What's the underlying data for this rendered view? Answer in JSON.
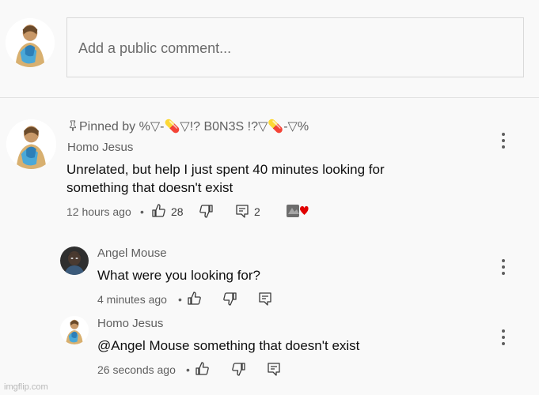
{
  "new_comment": {
    "placeholder": "Add a public comment..."
  },
  "pinned_comment": {
    "pinned_label": "Pinned by %▽-💊▽!? B0N3S !?▽💊-▽%",
    "author": "Homo Jesus",
    "text_line1": "Unrelated, but help I just spent 40 minutes looking for",
    "text_line2": "something that doesn't exist",
    "time": "12 hours ago",
    "likes": "28",
    "replies_count": "2"
  },
  "replies": [
    {
      "author": "Angel Mouse",
      "text": "What were you looking for?",
      "time": "4 minutes ago"
    },
    {
      "author": "Homo Jesus",
      "text": "@Angel Mouse  something that doesn't exist",
      "time": "26 seconds ago"
    }
  ],
  "watermark": "imgflip.com",
  "colors": {
    "text_primary": "#0f0f0f",
    "text_secondary": "#606060",
    "border": "#d9d9d9",
    "heart": "#e00000"
  }
}
